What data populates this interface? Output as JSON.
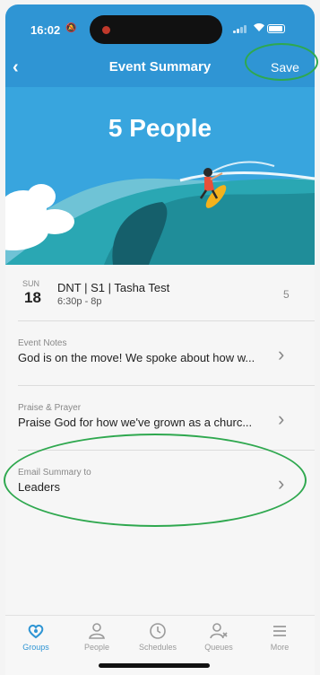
{
  "status_bar": {
    "time": "16:02",
    "icons": [
      "silent-bell-icon",
      "signal-icon",
      "wifi-icon",
      "battery-icon"
    ]
  },
  "navbar": {
    "back_icon": "chevron-left-icon",
    "title": "Event Summary",
    "save_label": "Save"
  },
  "hero": {
    "title": "5 People"
  },
  "event": {
    "weekday": "SUN",
    "day": "18",
    "title": "DNT | S1 | Tasha Test",
    "time": "6:30p - 8p",
    "count": "5"
  },
  "rows": [
    {
      "label": "Event Notes",
      "value": "God is on the move! We spoke about how w..."
    },
    {
      "label": "Praise & Prayer",
      "value": "Praise God for how we've grown as a churc..."
    },
    {
      "label": "Email Summary to",
      "value": "Leaders"
    }
  ],
  "tabs": [
    {
      "label": "Groups",
      "icon": "groups-icon",
      "active": true
    },
    {
      "label": "People",
      "icon": "people-icon",
      "active": false
    },
    {
      "label": "Schedules",
      "icon": "clock-icon",
      "active": false
    },
    {
      "label": "Queues",
      "icon": "queues-icon",
      "active": false
    },
    {
      "label": "More",
      "icon": "menu-icon",
      "active": false
    }
  ],
  "colors": {
    "accent": "#2f95d4",
    "hero_bg": "#38a5de",
    "annotation": "#2fa84f"
  }
}
